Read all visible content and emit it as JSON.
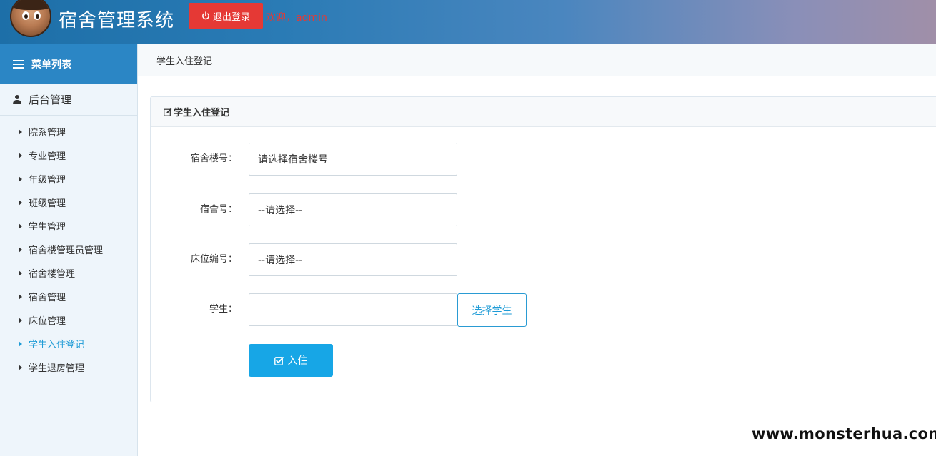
{
  "header": {
    "app_title": "宿舍管理系统",
    "logout_label": "退出登录",
    "welcome_text": "欢迎，admin"
  },
  "sidebar": {
    "title": "菜单列表",
    "section_title": "后台管理",
    "items": [
      {
        "label": "院系管理"
      },
      {
        "label": "专业管理"
      },
      {
        "label": "年级管理"
      },
      {
        "label": "班级管理"
      },
      {
        "label": "学生管理"
      },
      {
        "label": "宿舍楼管理员管理"
      },
      {
        "label": "宿舍楼管理"
      },
      {
        "label": "宿舍管理"
      },
      {
        "label": "床位管理"
      },
      {
        "label": "学生入住登记",
        "active": true
      },
      {
        "label": "学生退房管理"
      }
    ]
  },
  "breadcrumb": {
    "current": "学生入住登记"
  },
  "panel": {
    "title": "学生入住登记",
    "fields": {
      "building": {
        "label": "宿舍楼号：",
        "value": "请选择宿舍楼号"
      },
      "room": {
        "label": "宿舍号：",
        "value": "--请选择--"
      },
      "bed": {
        "label": "床位编号：",
        "value": "--请选择--"
      },
      "student": {
        "label": "学生：",
        "value": ""
      }
    },
    "choose_student_label": "选择学生",
    "submit_label": "入住"
  },
  "watermark": "www.monsterhua.com",
  "colors": {
    "accent": "#1e9bd6",
    "logout": "#e53935",
    "sidebar_header": "#2b86c5",
    "submit": "#17a6e6"
  }
}
